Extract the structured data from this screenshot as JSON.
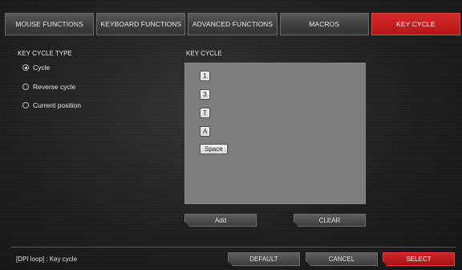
{
  "tabs": [
    {
      "label": "MOUSE FUNCTIONS",
      "active": false
    },
    {
      "label": "KEYBOARD FUNCTIONS",
      "active": false
    },
    {
      "label": "ADVANCED FUNCTIONS",
      "active": false
    },
    {
      "label": "MACROS",
      "active": false
    },
    {
      "label": "KEY CYCLE",
      "active": true
    }
  ],
  "key_cycle_type": {
    "label": "KEY CYCLE TYPE",
    "options": [
      {
        "label": "Cycle",
        "selected": true
      },
      {
        "label": "Reverse cycle",
        "selected": false
      },
      {
        "label": "Current position",
        "selected": false
      }
    ]
  },
  "key_cycle": {
    "label": "KEY CYCLE",
    "keys": [
      "1",
      "3",
      "T",
      "A",
      "Space"
    ],
    "add_label": "Add",
    "clear_label": "CLEAR"
  },
  "footer": {
    "status": "[DPI loop] : Key cycle",
    "default_label": "DEFAULT",
    "cancel_label": "CANCEL",
    "select_label": "SELECT"
  },
  "colors": {
    "accent": "#c41c1c",
    "panel": "#7d7d7d",
    "background": "#1e1e1e"
  }
}
